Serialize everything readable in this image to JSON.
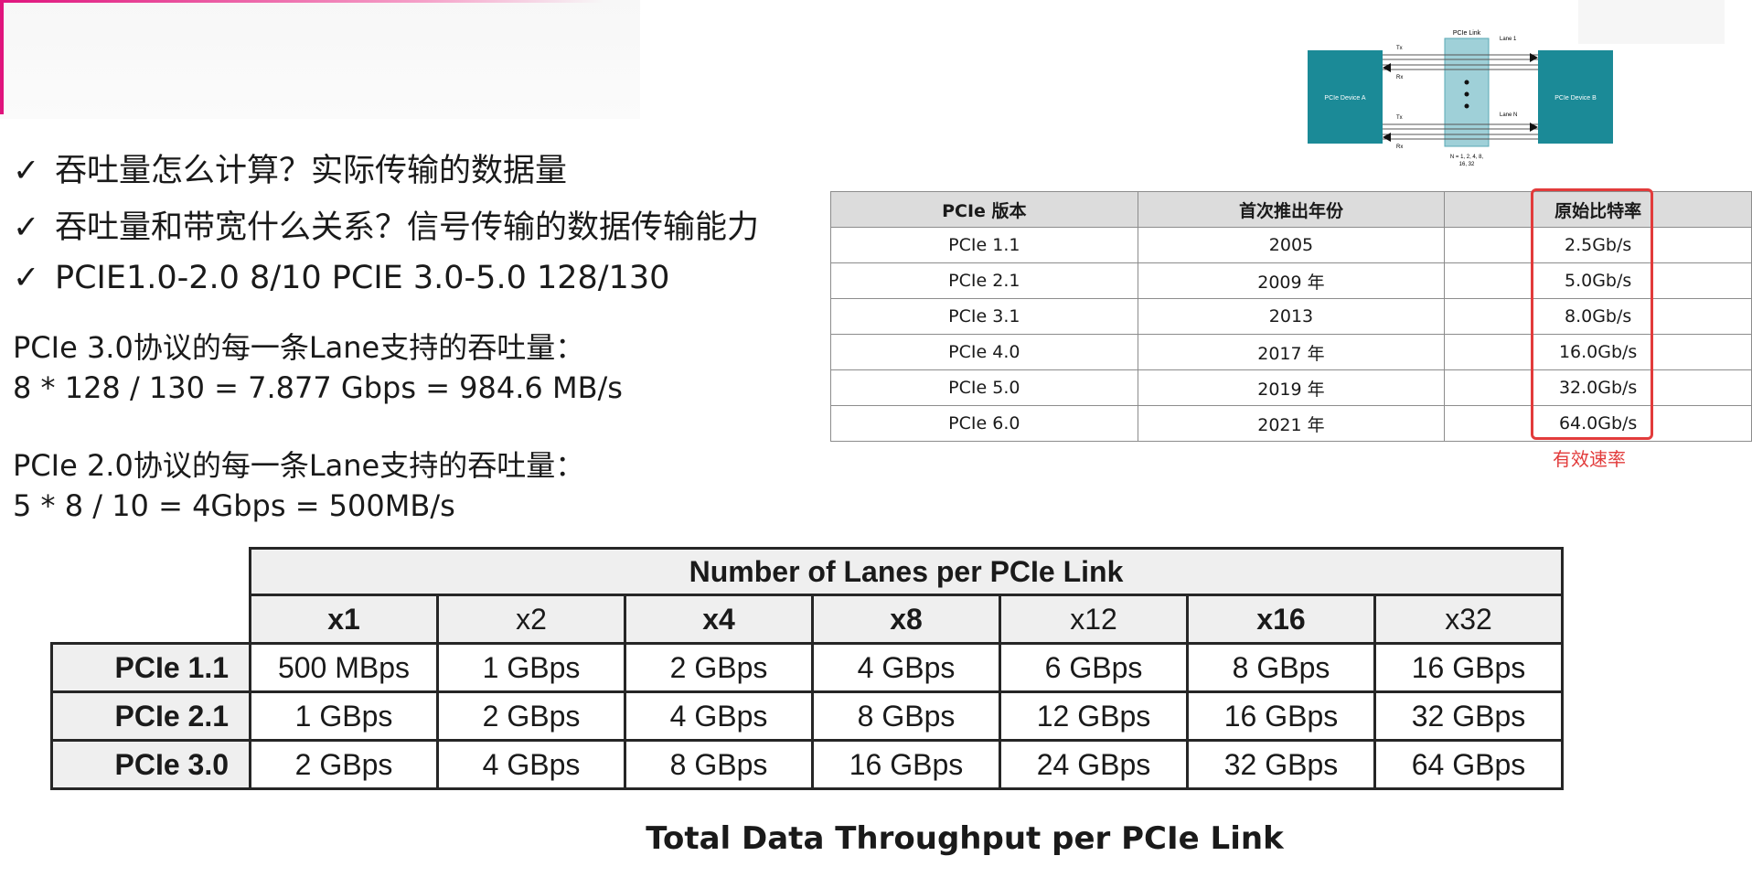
{
  "bullets": [
    {
      "check": "✓",
      "text": "吞吐量怎么计算？实际传输的数据量"
    },
    {
      "check": "✓",
      "text": "吞吐量和带宽什么关系？信号传输的数据传输能力"
    },
    {
      "check": "✓",
      "text": "PCIE1.0-2.0  8/10  PCIE 3.0-5.0 128/130"
    }
  ],
  "calc": {
    "pcie3_title": "PCIe 3.0协议的每一条Lane支持的吞吐量：",
    "pcie3_formula": "8 * 128 / 130 = 7.877 Gbps = 984.6 MB/s",
    "pcie2_title": "PCIe 2.0协议的每一条Lane支持的吞吐量：",
    "pcie2_formula": "5 * 8 / 10 = 4Gbps = 500MB/s"
  },
  "diagram": {
    "link_label": "PCIe Link",
    "device_a": "PCIe Device A",
    "device_b": "PCIe Device B",
    "lane1": "Lane 1",
    "laneN": "Lane N",
    "tx": "Tx",
    "rx": "Rx",
    "n_values": "N = 1, 2, 4, 8,",
    "n_values2": "16, 32",
    "teal": "#1b8a97"
  },
  "version_table": {
    "headers": [
      "PCIe 版本",
      "首次推出年份",
      "原始比特率"
    ],
    "rows": [
      [
        "PCIe 1.1",
        "2005",
        "2.5Gb/s"
      ],
      [
        "PCIe 2.1",
        "2009 年",
        "5.0Gb/s"
      ],
      [
        "PCIe 3.1",
        "2013",
        "8.0Gb/s"
      ],
      [
        "PCIe 4.0",
        "2017 年",
        "16.0Gb/s"
      ],
      [
        "PCIe 5.0",
        "2019 年",
        "32.0Gb/s"
      ],
      [
        "PCIe 6.0",
        "2021 年",
        "64.0Gb/s"
      ]
    ],
    "annotation": "有效速率",
    "highlight_color": "#e23b3b"
  },
  "lanes_table": {
    "title": "Number of Lanes per PCIe Link",
    "lanes": [
      "x1",
      "x2",
      "x4",
      "x8",
      "x12",
      "x16",
      "x32"
    ],
    "rows": [
      {
        "label": "PCIe 1.1",
        "cells": [
          "500 MBps",
          "1 GBps",
          "2 GBps",
          "4 GBps",
          "6 GBps",
          "8 GBps",
          "16 GBps"
        ]
      },
      {
        "label": "PCIe 2.1",
        "cells": [
          "1 GBps",
          "2 GBps",
          "4 GBps",
          "8 GBps",
          "12 GBps",
          "16 GBps",
          "32 GBps"
        ]
      },
      {
        "label": "PCIe 3.0",
        "cells": [
          "2 GBps",
          "4 GBps",
          "8 GBps",
          "16 GBps",
          "24 GBps",
          "32 GBps",
          "64 GBps"
        ]
      }
    ],
    "caption": "Total Data Throughput per PCIe Link"
  }
}
